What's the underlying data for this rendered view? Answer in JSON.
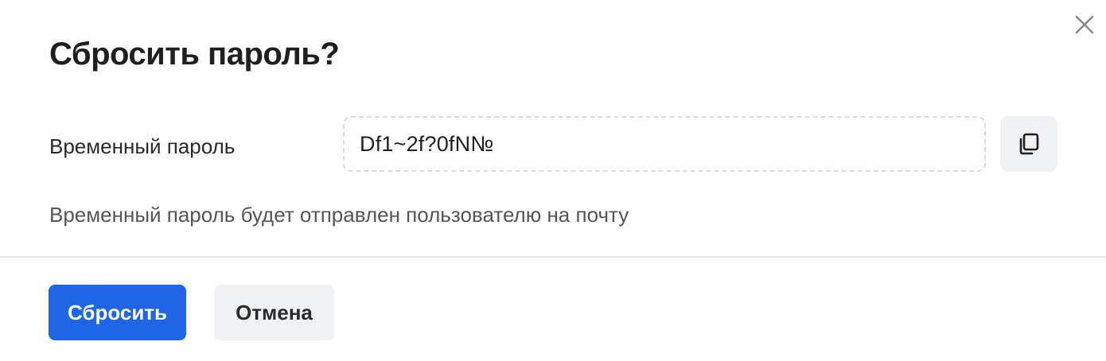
{
  "dialog": {
    "title": "Сбросить пароль?",
    "close_icon": "close-icon",
    "temp_password": {
      "label": "Временный пароль",
      "value": "Df1~2f?0fN№",
      "copy_icon": "copy-icon"
    },
    "hint": "Временный пароль будет отправлен пользователю на почту",
    "actions": {
      "reset_label": "Сбросить",
      "cancel_label": "Отмена"
    }
  },
  "colors": {
    "primary": "#1e66e6",
    "secondary_bg": "#f1f2f4",
    "divider": "#e6e6e6",
    "hint_text": "#555555"
  }
}
